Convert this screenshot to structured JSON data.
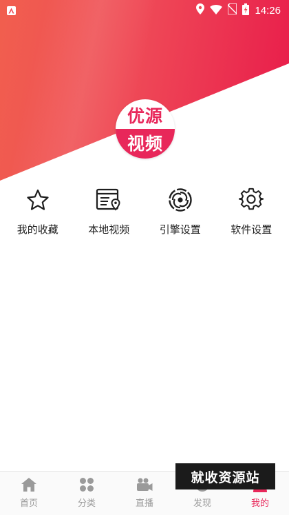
{
  "status_bar": {
    "time": "14:26"
  },
  "logo": {
    "line1": "优源",
    "line2": "视频"
  },
  "menu": [
    {
      "label": "我的收藏",
      "icon": "star-icon"
    },
    {
      "label": "本地视频",
      "icon": "local-video-icon"
    },
    {
      "label": "引擎设置",
      "icon": "engine-icon"
    },
    {
      "label": "软件设置",
      "icon": "gear-icon"
    }
  ],
  "bottom_nav": {
    "active": "我的",
    "items": [
      {
        "label": "首页",
        "icon": "home-icon"
      },
      {
        "label": "分类",
        "icon": "category-icon"
      },
      {
        "label": "直播",
        "icon": "live-icon"
      },
      {
        "label": "发现",
        "icon": "discover-icon"
      },
      {
        "label": "我的",
        "icon": "profile-icon"
      }
    ]
  },
  "watermark": "就收资源站",
  "colors": {
    "accent": "#e8275a",
    "banner_left": "#f15f4e",
    "banner_right": "#e81a4a",
    "nav_inactive": "#9a9a9a"
  }
}
